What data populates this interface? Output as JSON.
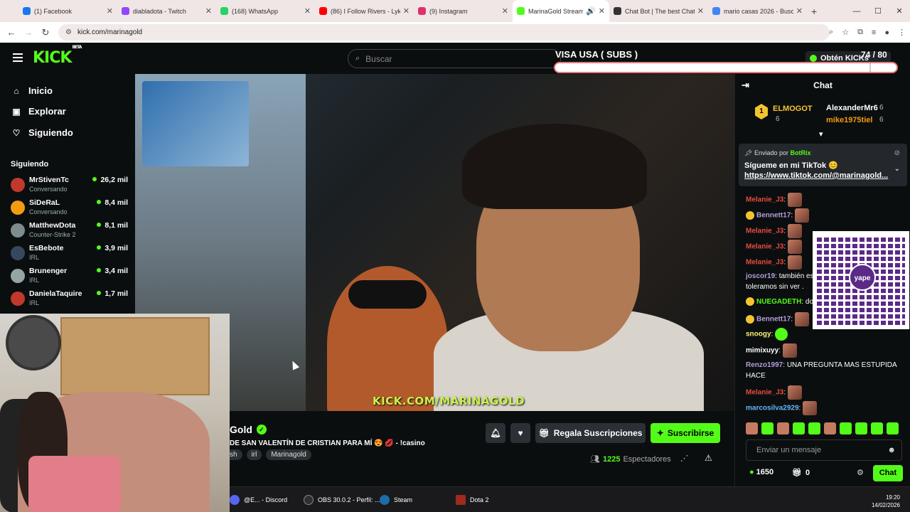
{
  "browser": {
    "tabs": [
      {
        "label": "(1) Facebook",
        "color": "#1877f2"
      },
      {
        "label": "diabladota - Twitch",
        "color": "#9146ff"
      },
      {
        "label": "(168) WhatsApp",
        "color": "#25d366"
      },
      {
        "label": "(86) I Follow Rivers - Lykk",
        "color": "#ff0000"
      },
      {
        "label": "(9) Instagram",
        "color": "#e1306c"
      },
      {
        "label": "MarinaGold Stream -",
        "color": "#53fc18"
      },
      {
        "label": "Chat Bot | The best ChatB",
        "color": "#333333"
      },
      {
        "label": "mario casas 2026 - Busca",
        "color": "#4285f4"
      }
    ],
    "url": "kick.com/marinagold"
  },
  "header": {
    "logo": "KICK",
    "logo_beta": "BETA",
    "search_placeholder": "Buscar",
    "obtain_label": "Obtén KICKs"
  },
  "overlay": {
    "title": "VISA USA ( SUBS )",
    "count": "74 / 80",
    "progress": 0.925
  },
  "sidebar": {
    "nav": [
      "Inicio",
      "Explorar",
      "Siguiendo"
    ],
    "following_title": "Siguiendo",
    "following": [
      {
        "name": "MrStivenTc",
        "category": "Conversando",
        "viewers": "26,2 mil",
        "color": "#c0392b"
      },
      {
        "name": "SiDeRaL",
        "category": "Conversando",
        "viewers": "8,4 mil",
        "color": "#f39c12"
      },
      {
        "name": "MatthewDota",
        "category": "Counter-Strike 2",
        "viewers": "8,1 mil",
        "color": "#7f8c8d"
      },
      {
        "name": "EsBebote",
        "category": "IRL",
        "viewers": "3,9 mil",
        "color": "#34495e"
      },
      {
        "name": "Brunenger",
        "category": "IRL",
        "viewers": "3,4 mil",
        "color": "#95a5a6"
      },
      {
        "name": "DanielaTaquire",
        "category": "IRL",
        "viewers": "1,7 mil",
        "color": "#c0392b"
      }
    ]
  },
  "video": {
    "watermark": "KICK.COM/MARINAGOLD"
  },
  "stream": {
    "name": "Gold",
    "title": "DE SAN VALENTÍN DE CRISTIAN PARA MÍ 😍 💋 - !casino",
    "tags": [
      "sh",
      "irl",
      "Marinagold"
    ],
    "gift_label": "Regala Suscripciones",
    "subscribe_label": "Suscribirse",
    "viewers": "1225",
    "viewers_label": "Espectadores"
  },
  "chat": {
    "title": "Chat",
    "leaders": [
      {
        "name": "ELMOGOT",
        "count": "6"
      },
      {
        "name": "AlexanderMr6",
        "count": "6"
      },
      {
        "name": "mike1975tiel",
        "count": "6"
      }
    ],
    "pinned": {
      "by_label": "Enviado por",
      "by_user": "BotRix",
      "text": "Sígueme en mi TikTok 😊",
      "link": "https://www.tiktok.com/@marinagold..."
    },
    "messages": [
      {
        "user": "Melanie_J3",
        "text": "",
        "color": "#e74c3c"
      },
      {
        "user": "Bennett17",
        "text": "",
        "color": "#b39ddb"
      },
      {
        "user": "Melanie_J3",
        "text": "",
        "color": "#e74c3c"
      },
      {
        "user": "Melanie_J3",
        "text": "",
        "color": "#e74c3c"
      },
      {
        "user": "Melanie_J3",
        "text": "",
        "color": "#e74c3c"
      },
      {
        "user": "joscor19",
        "text": "también es",
        "text2": "toleramos sin ver .",
        "color": "#b39ddb"
      },
      {
        "user": "NUEGADETH",
        "text": "do",
        "color": "#53fc18"
      },
      {
        "user": "Bennett17",
        "text": "",
        "color": "#b39ddb"
      },
      {
        "user": "snoogy",
        "text": "",
        "color": "#fff176"
      },
      {
        "user": "mimixuyy",
        "text": "",
        "color": "#ffffff"
      },
      {
        "user": "Renzo1997",
        "text": "UNA PREGUNTA MAS ESTUPIDA",
        "text2": "HACE",
        "color": "#b39ddb"
      },
      {
        "user": "Melanie_J3",
        "text": "",
        "color": "#e74c3c"
      },
      {
        "user": "marcosilva2929",
        "text": "",
        "color": "#64b5f6"
      }
    ],
    "qr_label": "yape",
    "input_placeholder": "Enviar un mensaje",
    "points": "1650",
    "gifts": "0",
    "send_label": "Chat"
  },
  "taskbar": {
    "items": [
      "@E... - Discord",
      "OBS 30.0.2 - Perfil: ...",
      "Steam",
      "Dota 2"
    ],
    "time": "19:20",
    "date": "14/02/2026"
  }
}
